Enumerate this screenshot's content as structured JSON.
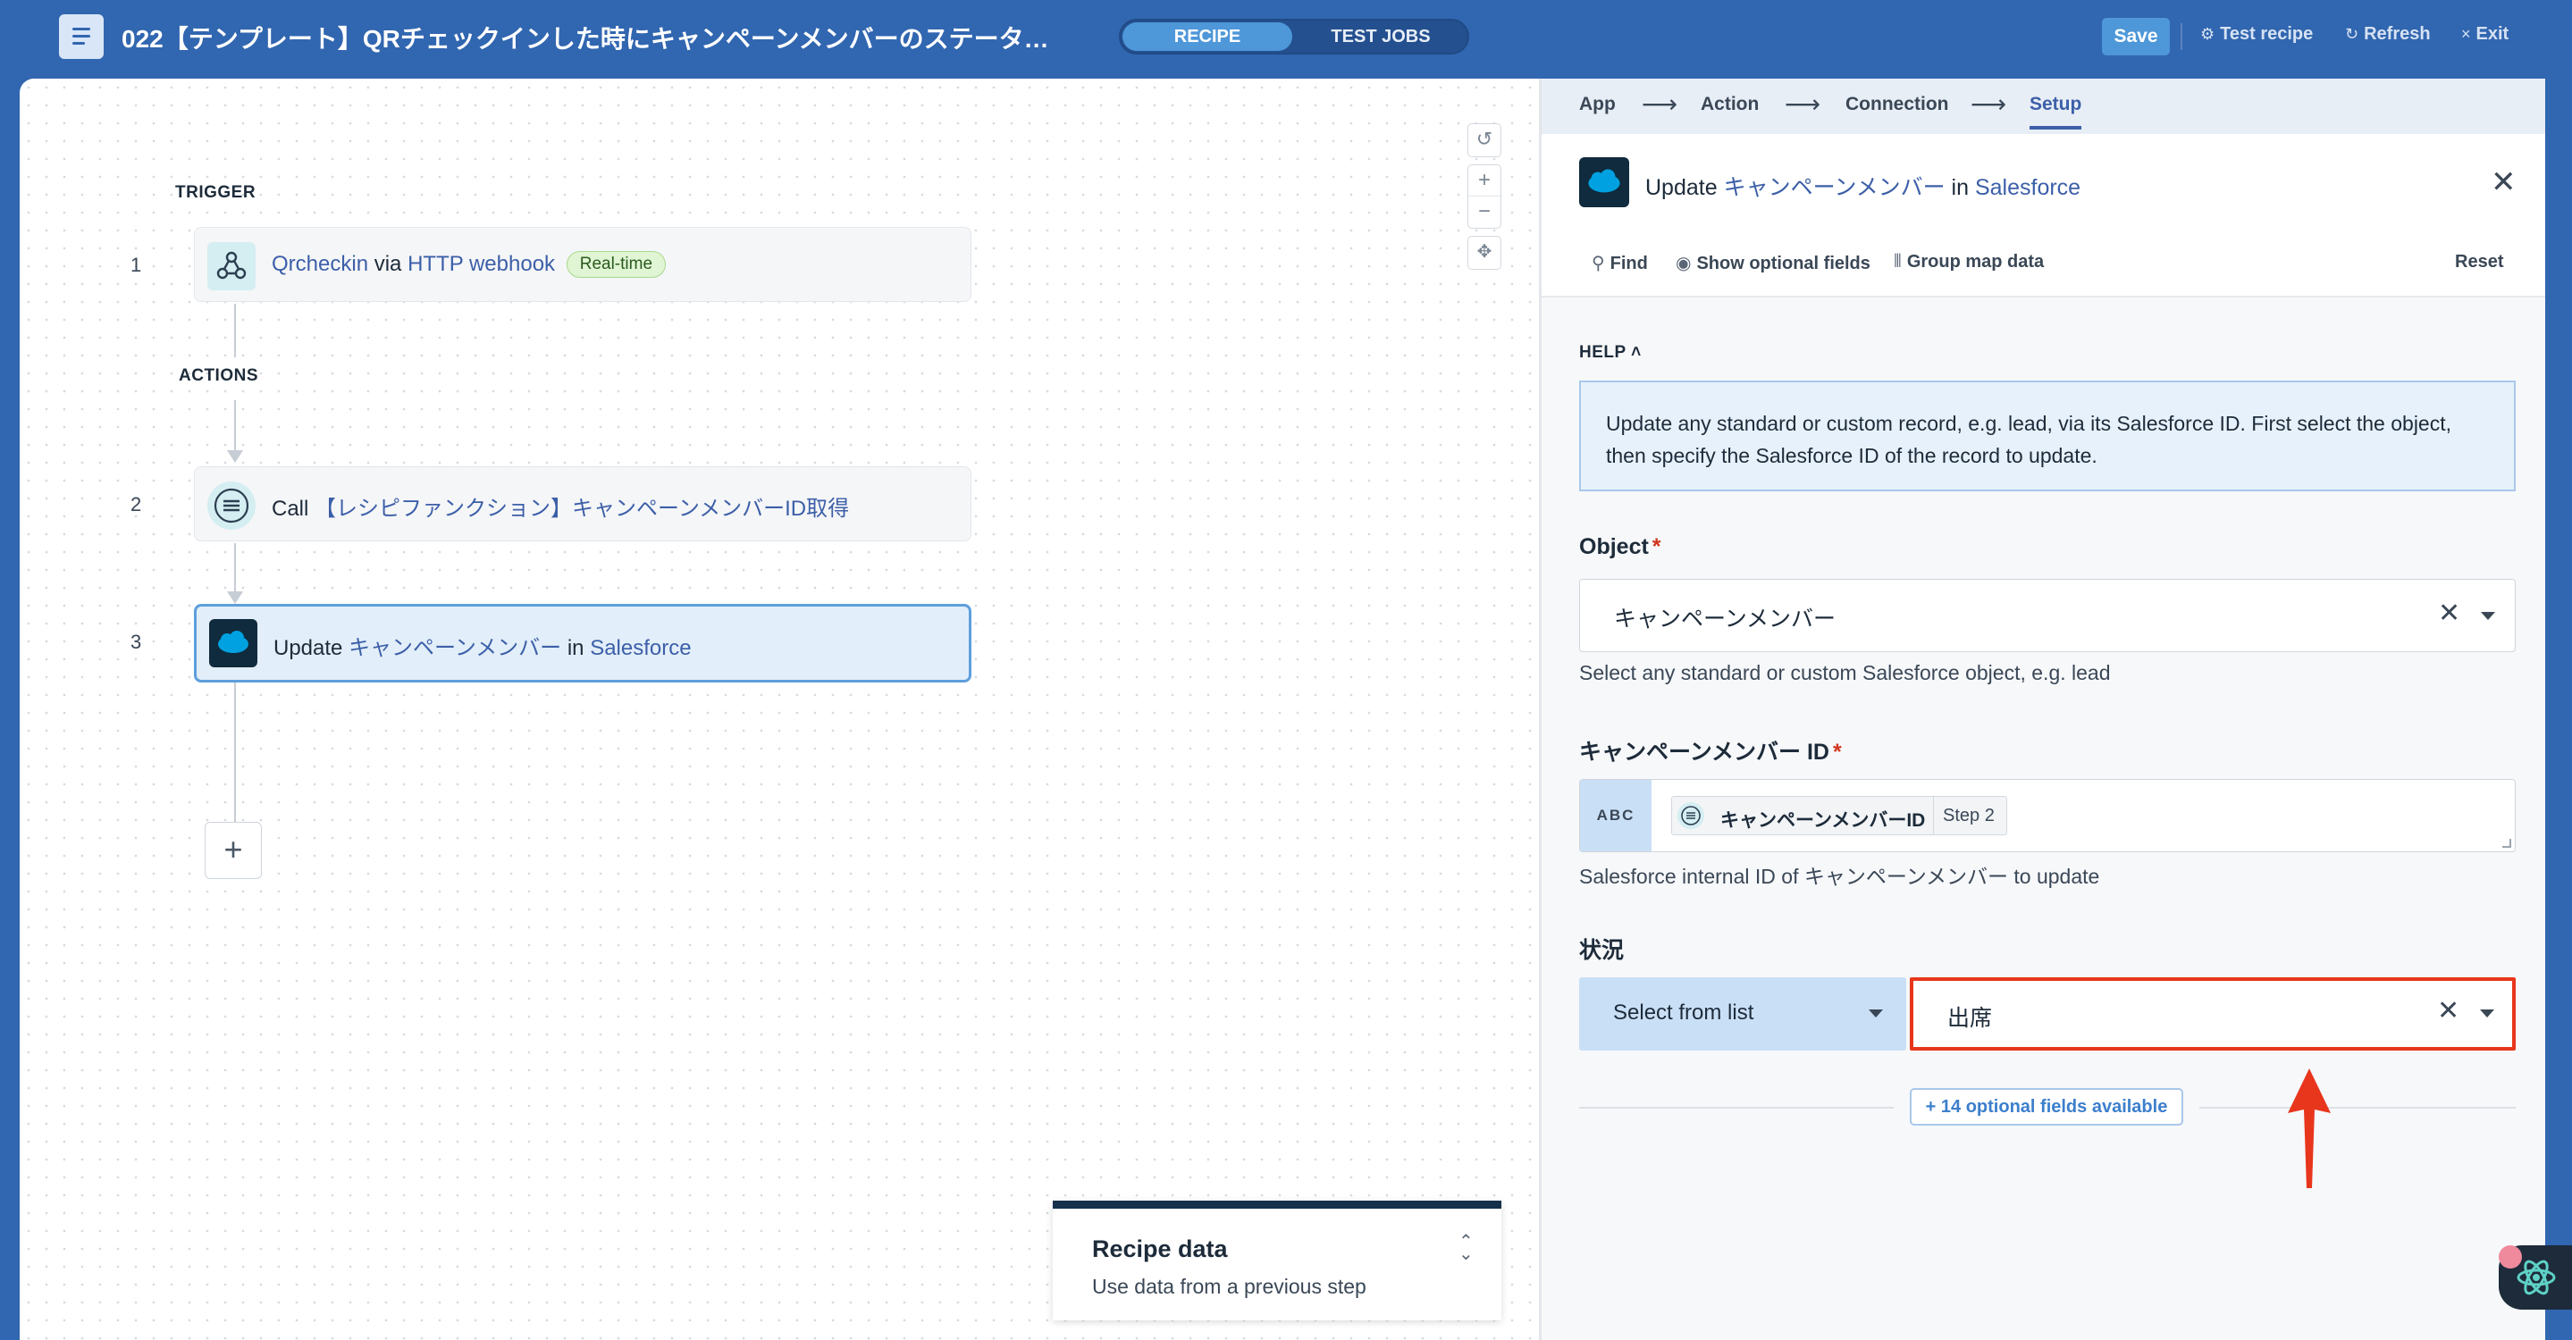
{
  "header": {
    "title": "022【テンプレート】QRチェックインした時にキャンペーンメンバーのステータ…",
    "tabs": {
      "recipe": "RECIPE",
      "test_jobs": "TEST JOBS"
    },
    "save_label": "Save",
    "test_recipe_label": "Test recipe",
    "refresh_label": "Refresh",
    "exit_label": "Exit"
  },
  "canvas": {
    "trigger_label": "TRIGGER",
    "actions_label": "ACTIONS",
    "steps": [
      {
        "number": "1",
        "app": "Qrcheckin",
        "connector": "via",
        "target": "HTTP webhook",
        "badge": "Real-time",
        "icon": "webhook-icon"
      },
      {
        "number": "2",
        "verb": "Call",
        "target": "【レシピファンクション】キャンペーンメンバーID取得",
        "icon": "recipe-function-icon"
      },
      {
        "number": "3",
        "verb": "Update",
        "object": "キャンペーンメンバー",
        "connector": "in",
        "app": "Salesforce",
        "icon": "salesforce-icon"
      }
    ],
    "add_step_label": "+",
    "recipe_data": {
      "title": "Recipe data",
      "subtitle": "Use data from a previous step"
    }
  },
  "panel": {
    "breadcrumbs": [
      "App",
      "Action",
      "Connection",
      "Setup"
    ],
    "active_crumb": "Setup",
    "title": {
      "verb": "Update",
      "object": "キャンペーンメンバー",
      "connector": "in",
      "app": "Salesforce"
    },
    "tools": {
      "find": "Find",
      "show_optional": "Show optional fields",
      "group_map": "Group map data",
      "reset": "Reset"
    },
    "help": {
      "label": "HELP",
      "text": "Update any standard or custom record, e.g. lead, via its Salesforce ID. First select the object, then specify the Salesforce ID of the record to update."
    },
    "object_field": {
      "label": "Object",
      "value": "キャンペーンメンバー",
      "hint": "Select any standard or custom Salesforce object, e.g. lead"
    },
    "id_field": {
      "label": "キャンペーンメンバー ID",
      "type_tag": "ABC",
      "pill_text": "キャンペーンメンバーID",
      "pill_step": "Step 2",
      "hint": "Salesforce internal ID of キャンペーンメンバー to update"
    },
    "status_field": {
      "label": "状況",
      "mode": "Select from list",
      "value": "出席"
    },
    "optional_fields": "+ 14 optional fields available"
  },
  "colors": {
    "header_bg": "#3166b0",
    "accent": "#4e97d8",
    "link": "#3c5fa8",
    "highlight_border": "#e8361c"
  }
}
